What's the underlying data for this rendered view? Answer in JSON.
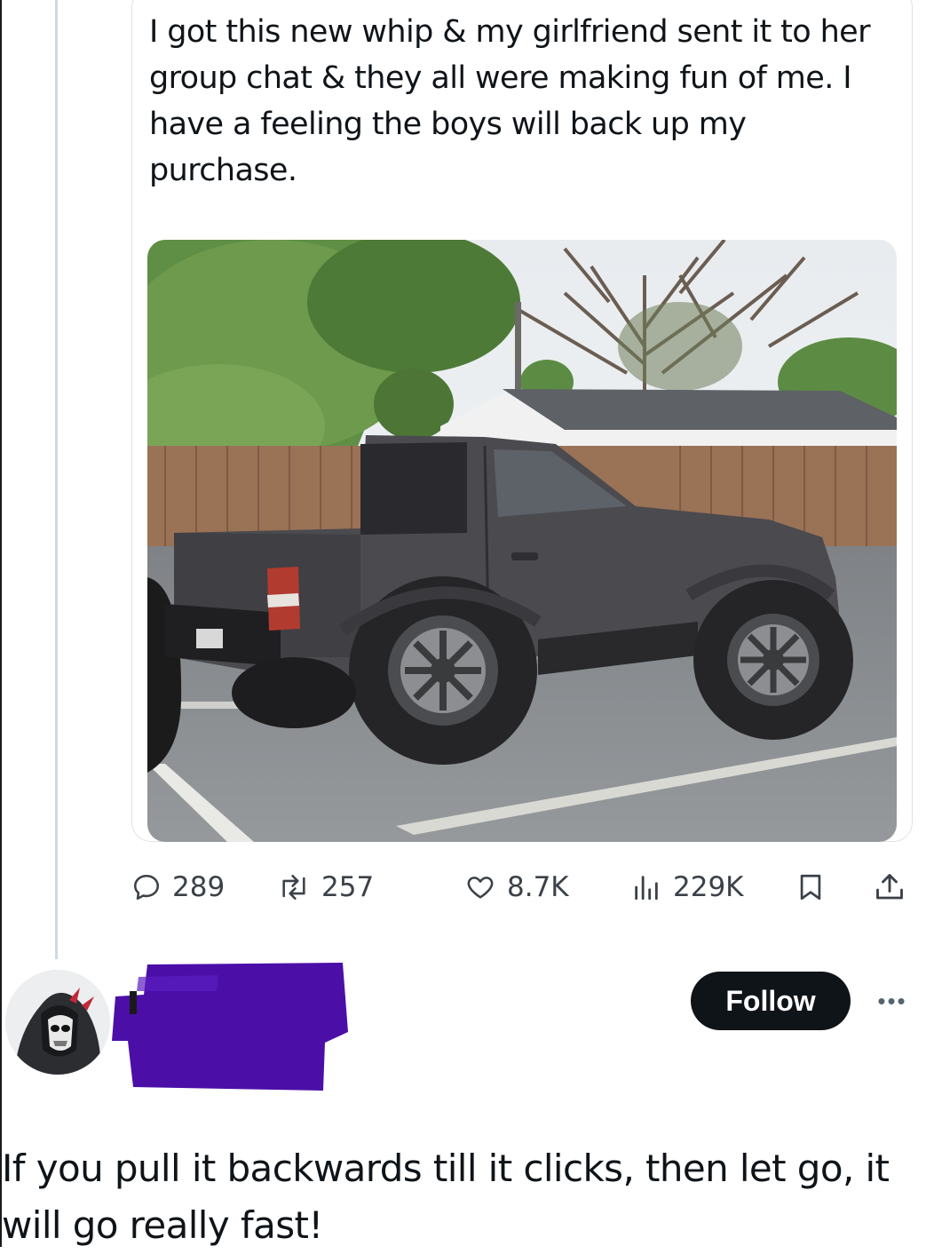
{
  "quoted_post": {
    "text": "I got this new whip & my girlfriend sent it to her group chat & they all were making fun of me. I have a feeling the boys will back up my purchase.",
    "media_alt": "photo of a lifted black pickup truck with oversized wheels in a parking lot"
  },
  "stats": {
    "replies": "289",
    "reposts": "257",
    "likes": "8.7K",
    "views": "229K"
  },
  "icons": {
    "reply": "reply-icon",
    "repost": "repost-icon",
    "like": "heart-icon",
    "views": "bar-chart-icon",
    "bookmark": "bookmark-icon",
    "share": "share-icon",
    "more": "more-horizontal-icon"
  },
  "reply_author": {
    "follow_label": "Follow",
    "more_label": "•••"
  },
  "reply_post": {
    "text": "If you pull it backwards till it clicks, then let go, it will go really fast!"
  },
  "colors": {
    "follow_bg": "#0f1419",
    "redaction": "#4b0fa8",
    "icon_gray": "#536471"
  }
}
